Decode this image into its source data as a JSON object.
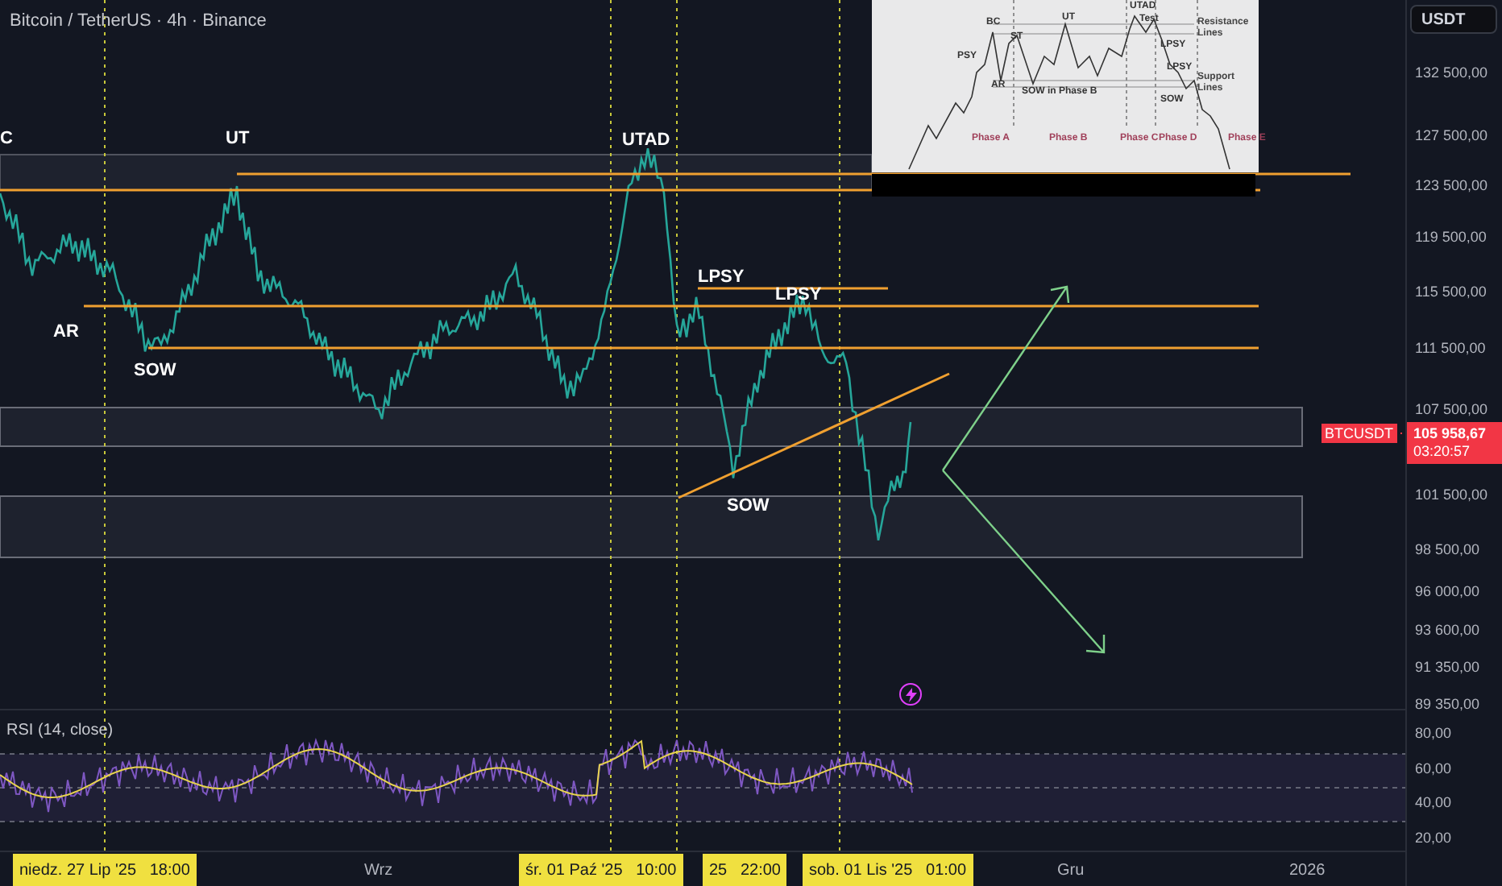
{
  "header": {
    "title": "Bitcoin / TetherUS · 4h · Binance"
  },
  "annotations": [
    "C",
    "UT",
    "UTAD",
    "LPSY",
    "LPSY",
    "AR",
    "SOW",
    "SOW"
  ],
  "inset": {
    "labels": [
      "BC",
      "UT",
      "UTAD",
      "Test",
      "Resistance Lines",
      "PSY",
      "ST",
      "LPSY",
      "AR",
      "SOW in Phase B",
      "LPSY",
      "Support Lines",
      "SOW",
      "Phase A",
      "Phase B",
      "Phase C",
      "Phase D",
      "Phase E"
    ]
  },
  "price_axis": {
    "currency": "USDT",
    "ticks": [
      "132 500,00",
      "127 500,00",
      "123 500,00",
      "119 500,00",
      "115 500,00",
      "111 500,00",
      "107 500,00",
      "101 500,00",
      "98 500,00",
      "96 000,00",
      "93 600,00",
      "91 350,00",
      "89 350,00"
    ]
  },
  "last_price": {
    "symbol": "BTCUSDT",
    "price": "105 958,67",
    "countdown": "03:20:57"
  },
  "rsi": {
    "title": "RSI (14, close)",
    "ticks": [
      "80,00",
      "60,00",
      "40,00",
      "20,00"
    ]
  },
  "time_axis": [
    {
      "label": "niedz. 27 Lip '25   18:00",
      "highlighted": true
    },
    {
      "label": "Wrz",
      "highlighted": false
    },
    {
      "label": "śr. 01 Paź '25   10:00",
      "highlighted": true
    },
    {
      "label": "25   22:00",
      "highlighted": true
    },
    {
      "label": "sob. 01 Lis '25   01:00",
      "highlighted": true
    },
    {
      "label": "Gru",
      "highlighted": false
    },
    {
      "label": "2026",
      "highlighted": false
    }
  ]
}
